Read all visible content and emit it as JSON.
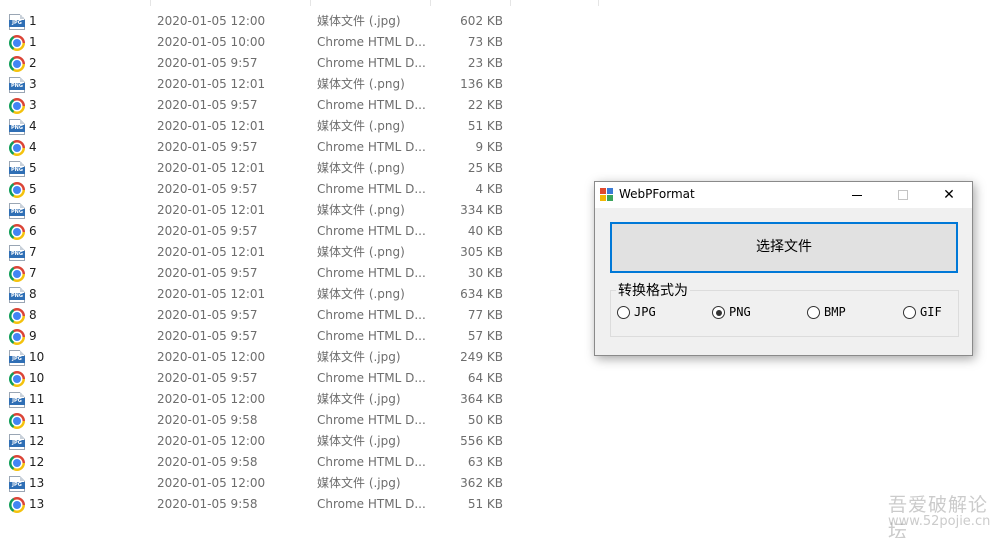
{
  "files": [
    {
      "name": "1",
      "icon": "jpg",
      "date": "2020-01-05 12:00",
      "type": "媒体文件 (.jpg)",
      "size": "602 KB"
    },
    {
      "name": "1",
      "icon": "chrome",
      "date": "2020-01-05 10:00",
      "type": "Chrome HTML D...",
      "size": "73 KB"
    },
    {
      "name": "2",
      "icon": "chrome",
      "date": "2020-01-05 9:57",
      "type": "Chrome HTML D...",
      "size": "23 KB"
    },
    {
      "name": "3",
      "icon": "png",
      "date": "2020-01-05 12:01",
      "type": "媒体文件 (.png)",
      "size": "136 KB"
    },
    {
      "name": "3",
      "icon": "chrome",
      "date": "2020-01-05 9:57",
      "type": "Chrome HTML D...",
      "size": "22 KB"
    },
    {
      "name": "4",
      "icon": "png",
      "date": "2020-01-05 12:01",
      "type": "媒体文件 (.png)",
      "size": "51 KB"
    },
    {
      "name": "4",
      "icon": "chrome",
      "date": "2020-01-05 9:57",
      "type": "Chrome HTML D...",
      "size": "9 KB"
    },
    {
      "name": "5",
      "icon": "png",
      "date": "2020-01-05 12:01",
      "type": "媒体文件 (.png)",
      "size": "25 KB"
    },
    {
      "name": "5",
      "icon": "chrome",
      "date": "2020-01-05 9:57",
      "type": "Chrome HTML D...",
      "size": "4 KB"
    },
    {
      "name": "6",
      "icon": "png",
      "date": "2020-01-05 12:01",
      "type": "媒体文件 (.png)",
      "size": "334 KB"
    },
    {
      "name": "6",
      "icon": "chrome",
      "date": "2020-01-05 9:57",
      "type": "Chrome HTML D...",
      "size": "40 KB"
    },
    {
      "name": "7",
      "icon": "png",
      "date": "2020-01-05 12:01",
      "type": "媒体文件 (.png)",
      "size": "305 KB"
    },
    {
      "name": "7",
      "icon": "chrome",
      "date": "2020-01-05 9:57",
      "type": "Chrome HTML D...",
      "size": "30 KB"
    },
    {
      "name": "8",
      "icon": "png",
      "date": "2020-01-05 12:01",
      "type": "媒体文件 (.png)",
      "size": "634 KB"
    },
    {
      "name": "8",
      "icon": "chrome",
      "date": "2020-01-05 9:57",
      "type": "Chrome HTML D...",
      "size": "77 KB"
    },
    {
      "name": "9",
      "icon": "chrome",
      "date": "2020-01-05 9:57",
      "type": "Chrome HTML D...",
      "size": "57 KB"
    },
    {
      "name": "10",
      "icon": "jpg",
      "date": "2020-01-05 12:00",
      "type": "媒体文件 (.jpg)",
      "size": "249 KB"
    },
    {
      "name": "10",
      "icon": "chrome",
      "date": "2020-01-05 9:57",
      "type": "Chrome HTML D...",
      "size": "64 KB"
    },
    {
      "name": "11",
      "icon": "jpg",
      "date": "2020-01-05 12:00",
      "type": "媒体文件 (.jpg)",
      "size": "364 KB"
    },
    {
      "name": "11",
      "icon": "chrome",
      "date": "2020-01-05 9:58",
      "type": "Chrome HTML D...",
      "size": "50 KB"
    },
    {
      "name": "12",
      "icon": "jpg",
      "date": "2020-01-05 12:00",
      "type": "媒体文件 (.jpg)",
      "size": "556 KB"
    },
    {
      "name": "12",
      "icon": "chrome",
      "date": "2020-01-05 9:58",
      "type": "Chrome HTML D...",
      "size": "63 KB"
    },
    {
      "name": "13",
      "icon": "jpg",
      "date": "2020-01-05 12:00",
      "type": "媒体文件 (.jpg)",
      "size": "362 KB"
    },
    {
      "name": "13",
      "icon": "chrome",
      "date": "2020-01-05 9:58",
      "type": "Chrome HTML D...",
      "size": "51 KB"
    }
  ],
  "icon_tags": {
    "jpg": "JPG",
    "png": "PNG"
  },
  "window": {
    "title": "WebPFormat",
    "title_icon": "app-icon",
    "minimize_glyph": "minimize-icon",
    "maximize_glyph": "maximize-icon",
    "close_glyph": "✕",
    "choose_button": "选择文件",
    "group_title": "转换格式为",
    "formats": [
      {
        "label": "JPG",
        "selected": false
      },
      {
        "label": "PNG",
        "selected": true
      },
      {
        "label": "BMP",
        "selected": false
      },
      {
        "label": "GIF",
        "selected": false
      }
    ]
  },
  "watermark": {
    "line1": "吾爱破解论坛",
    "line2": "www.52pojie.cn"
  },
  "colors": {
    "accent": "#0078d7",
    "window_bg": "#f0f0f0",
    "secondary_text": "#6d6d6d"
  }
}
